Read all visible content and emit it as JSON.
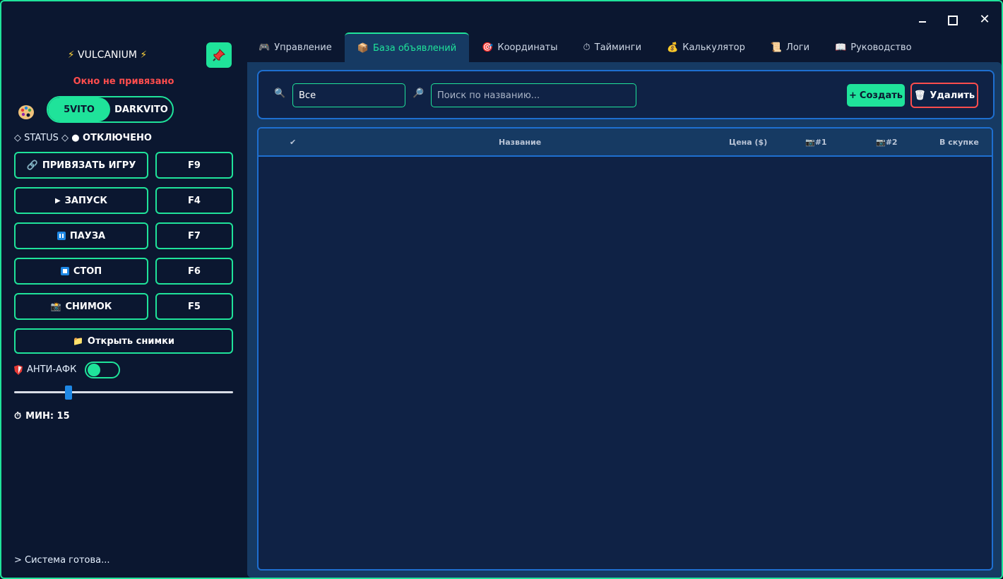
{
  "window": {
    "controls": {
      "minimize": "minimize",
      "maximize": "maximize",
      "close": "✕"
    }
  },
  "sidebar": {
    "brand": "VULCANIUM",
    "warning": "Окно не привязано",
    "mode_toggle": {
      "option1": "5VITO",
      "option2": "DARKVITO",
      "active": "5VITO"
    },
    "status_label": "◇ STATUS ◇",
    "status_value": "● ОТКЛЮЧЕНО",
    "buttons": [
      {
        "label": "ПРИВЯЗАТЬ ИГРУ",
        "key": "F9",
        "icon": "link-icon"
      },
      {
        "label": "ЗАПУСК",
        "key": "F4",
        "icon": "play-icon"
      },
      {
        "label": "ПАУЗА",
        "key": "F7",
        "icon": "pause-icon"
      },
      {
        "label": "СТОП",
        "key": "F6",
        "icon": "stop-icon"
      },
      {
        "label": "СНИМОК",
        "key": "F5",
        "icon": "camera-icon"
      }
    ],
    "open_screens": "Открыть снимки",
    "anti_afk": {
      "label": "АНТИ-АФК",
      "enabled": true
    },
    "slider_level": 0.25,
    "minutes_label": "МИН: 15",
    "console": "> Система готова..."
  },
  "tabs": [
    {
      "label": "Управление",
      "icon": "gamepad-icon",
      "active": false
    },
    {
      "label": "База объявлений",
      "icon": "box-icon",
      "active": true
    },
    {
      "label": "Координаты",
      "icon": "target-icon",
      "active": false
    },
    {
      "label": "Тайминги",
      "icon": "stopwatch-icon",
      "active": false
    },
    {
      "label": "Калькулятор",
      "icon": "money-bag-icon",
      "active": false
    },
    {
      "label": "Логи",
      "icon": "scroll-icon",
      "active": false
    },
    {
      "label": "Руководство",
      "icon": "book-icon",
      "active": false
    }
  ],
  "toolbar": {
    "filter_value": "Все",
    "search_placeholder": "Поиск по названию...",
    "create_label": "Создать",
    "delete_label": "Удалить"
  },
  "table": {
    "columns": [
      "✔",
      "Название",
      "Цена ($)",
      "#1",
      "#2",
      "В скупке"
    ],
    "rows": []
  },
  "colors": {
    "accent": "#1fe39a",
    "danger": "#ff4d4d",
    "background": "#0b1730",
    "panel": "#163a63",
    "border_blue": "#1e6fd0"
  }
}
